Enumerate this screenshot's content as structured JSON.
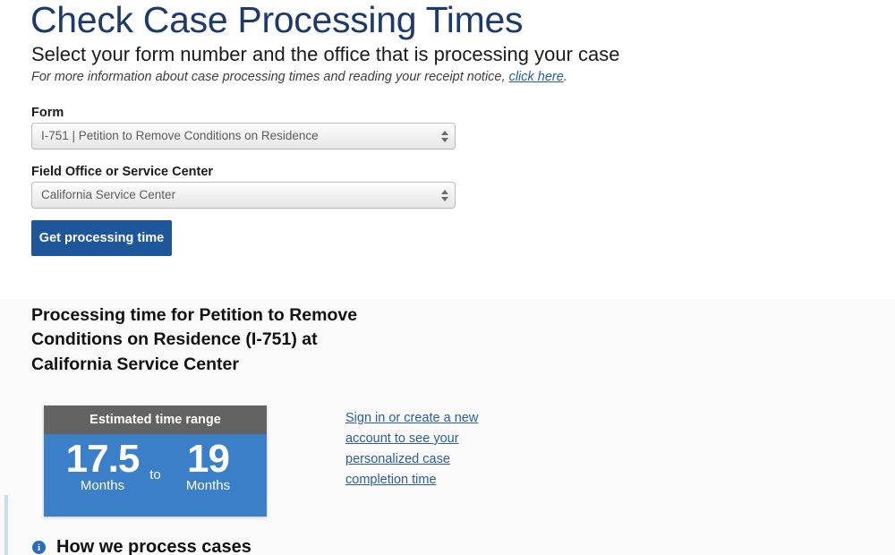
{
  "header": {
    "title": "Check Case Processing Times",
    "subtitle": "Select your form number and the office that is processing your case",
    "note_prefix": "For more information about case processing times and reading your receipt notice, ",
    "note_link": "click here",
    "note_suffix": "."
  },
  "form": {
    "form_label": "Form",
    "form_value": "I-751 | Petition to Remove Conditions on Residence",
    "office_label": "Field Office or Service Center",
    "office_value": "California Service Center",
    "submit_label": "Get processing time",
    "submit_color": "#1d5699",
    "stepper_icon": "up-down-stepper-icon"
  },
  "results": {
    "heading": "Processing time for Petition to Remove Conditions on Residence (I-751) at California Service Center",
    "range_card": {
      "header": "Estimated time range",
      "header_color": "#636363",
      "body_color": "#3a7fc8",
      "low_value": "17.5",
      "low_unit": "Months",
      "separator": "to",
      "high_value": "19",
      "high_unit": "Months"
    },
    "signin_link": "Sign in or create a new account to see your personalized case completion time",
    "how_section": {
      "icon": "info-circle-icon",
      "icon_glyph": "i",
      "title": "How we process cases"
    }
  }
}
